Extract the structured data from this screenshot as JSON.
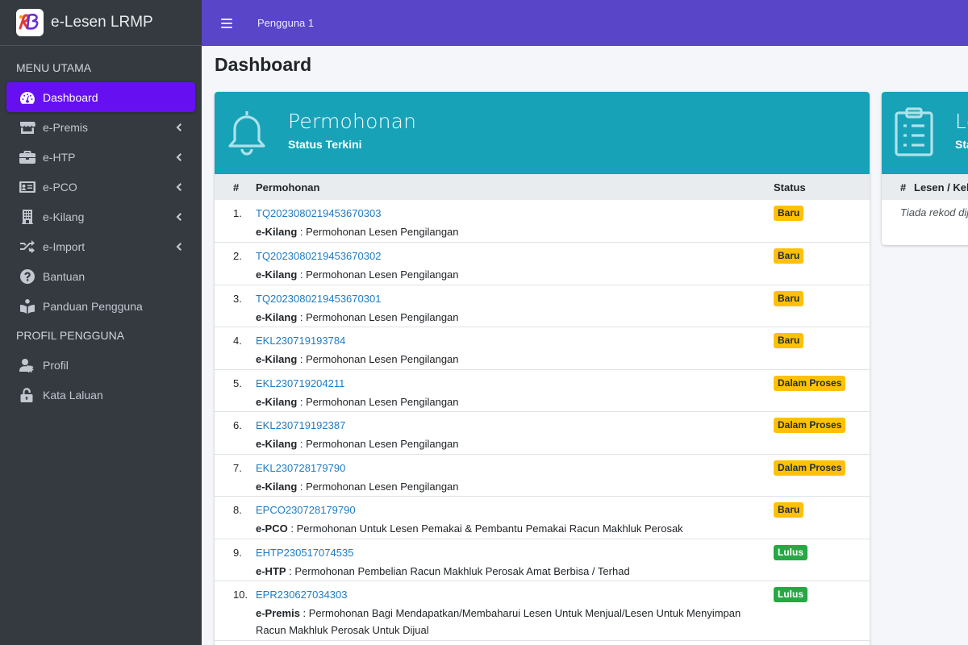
{
  "brand": {
    "name": "e-Lesen LRMP",
    "logo_text": "RB"
  },
  "sidebar": {
    "header_main": "MENU UTAMA",
    "items": [
      {
        "label": "Dashboard",
        "icon": "tachometer-icon",
        "active": true
      },
      {
        "label": "e-Premis",
        "icon": "store-icon",
        "submenu": true
      },
      {
        "label": "e-HTP",
        "icon": "briefcase-icon",
        "submenu": true
      },
      {
        "label": "e-PCO",
        "icon": "id-card-icon",
        "submenu": true
      },
      {
        "label": "e-Kilang",
        "icon": "building-icon",
        "submenu": true
      },
      {
        "label": "e-Import",
        "icon": "random-icon",
        "submenu": true
      },
      {
        "label": "Bantuan",
        "icon": "question-circle-icon"
      },
      {
        "label": "Panduan Pengguna",
        "icon": "book-reader-icon"
      }
    ],
    "header_profile": "PROFIL PENGGUNA",
    "profile_items": [
      {
        "label": "Profil",
        "icon": "user-cog-icon"
      },
      {
        "label": "Kata Laluan",
        "icon": "unlock-icon"
      }
    ]
  },
  "topbar": {
    "user": "Pengguna 1"
  },
  "page_title": "Dashboard",
  "permohonan_card": {
    "title": "Permohonan",
    "subtitle": "Status Terkini",
    "columns": [
      "#",
      "Permohonan",
      "Status"
    ],
    "rows": [
      {
        "num": "1.",
        "ref": "TQ2023080219453670303",
        "module": "e-Kilang",
        "desc": "Permohonan Lesen Pengilangan",
        "status": "Baru",
        "status_type": "warning"
      },
      {
        "num": "2.",
        "ref": "TQ2023080219453670302",
        "module": "e-Kilang",
        "desc": "Permohonan Lesen Pengilangan",
        "status": "Baru",
        "status_type": "warning"
      },
      {
        "num": "3.",
        "ref": "TQ2023080219453670301",
        "module": "e-Kilang",
        "desc": "Permohonan Lesen Pengilangan",
        "status": "Baru",
        "status_type": "warning"
      },
      {
        "num": "4.",
        "ref": "EKL230719193784",
        "module": "e-Kilang",
        "desc": "Permohonan Lesen Pengilangan",
        "status": "Baru",
        "status_type": "warning"
      },
      {
        "num": "5.",
        "ref": "EKL230719204211",
        "module": "e-Kilang",
        "desc": "Permohonan Lesen Pengilangan",
        "status": "Dalam Proses",
        "status_type": "warning"
      },
      {
        "num": "6.",
        "ref": "EKL230719192387",
        "module": "e-Kilang",
        "desc": "Permohonan Lesen Pengilangan",
        "status": "Dalam Proses",
        "status_type": "warning"
      },
      {
        "num": "7.",
        "ref": "EKL230728179790",
        "module": "e-Kilang",
        "desc": "Permohonan Lesen Pengilangan",
        "status": "Dalam Proses",
        "status_type": "warning"
      },
      {
        "num": "8.",
        "ref": "EPCO230728179790",
        "module": "e-PCO",
        "desc": "Permohonan Untuk Lesen Pemakai & Pembantu Pemakai Racun Makhluk Perosak",
        "status": "Baru",
        "status_type": "warning"
      },
      {
        "num": "9.",
        "ref": "EHTP230517074535",
        "module": "e-HTP",
        "desc": "Permohonan Pembelian Racun Makhluk Perosak Amat Berbisa / Terhad",
        "status": "Lulus",
        "status_type": "success"
      },
      {
        "num": "10.",
        "ref": "EPR230627034303",
        "module": "e-Premis",
        "desc": "Permohonan Bagi Mendapatkan/Membaharui Lesen Untuk Menjual/Lesen Untuk Menyimpan Racun Makhluk Perosak Untuk Dijual",
        "status": "Lulus",
        "status_type": "success"
      }
    ]
  },
  "lesen_card": {
    "title": "Le",
    "subtitle": "Sta",
    "columns": [
      "#",
      "Lesen / Kel"
    ],
    "empty": "Tiada rekod dij"
  },
  "colors": {
    "sidebar": "#343a40",
    "active": "#6610f2",
    "topbar": "#5845c8",
    "card_head": "#17a2b8",
    "warning": "#ffc107",
    "success": "#28a745",
    "link": "#1e7bc4"
  }
}
